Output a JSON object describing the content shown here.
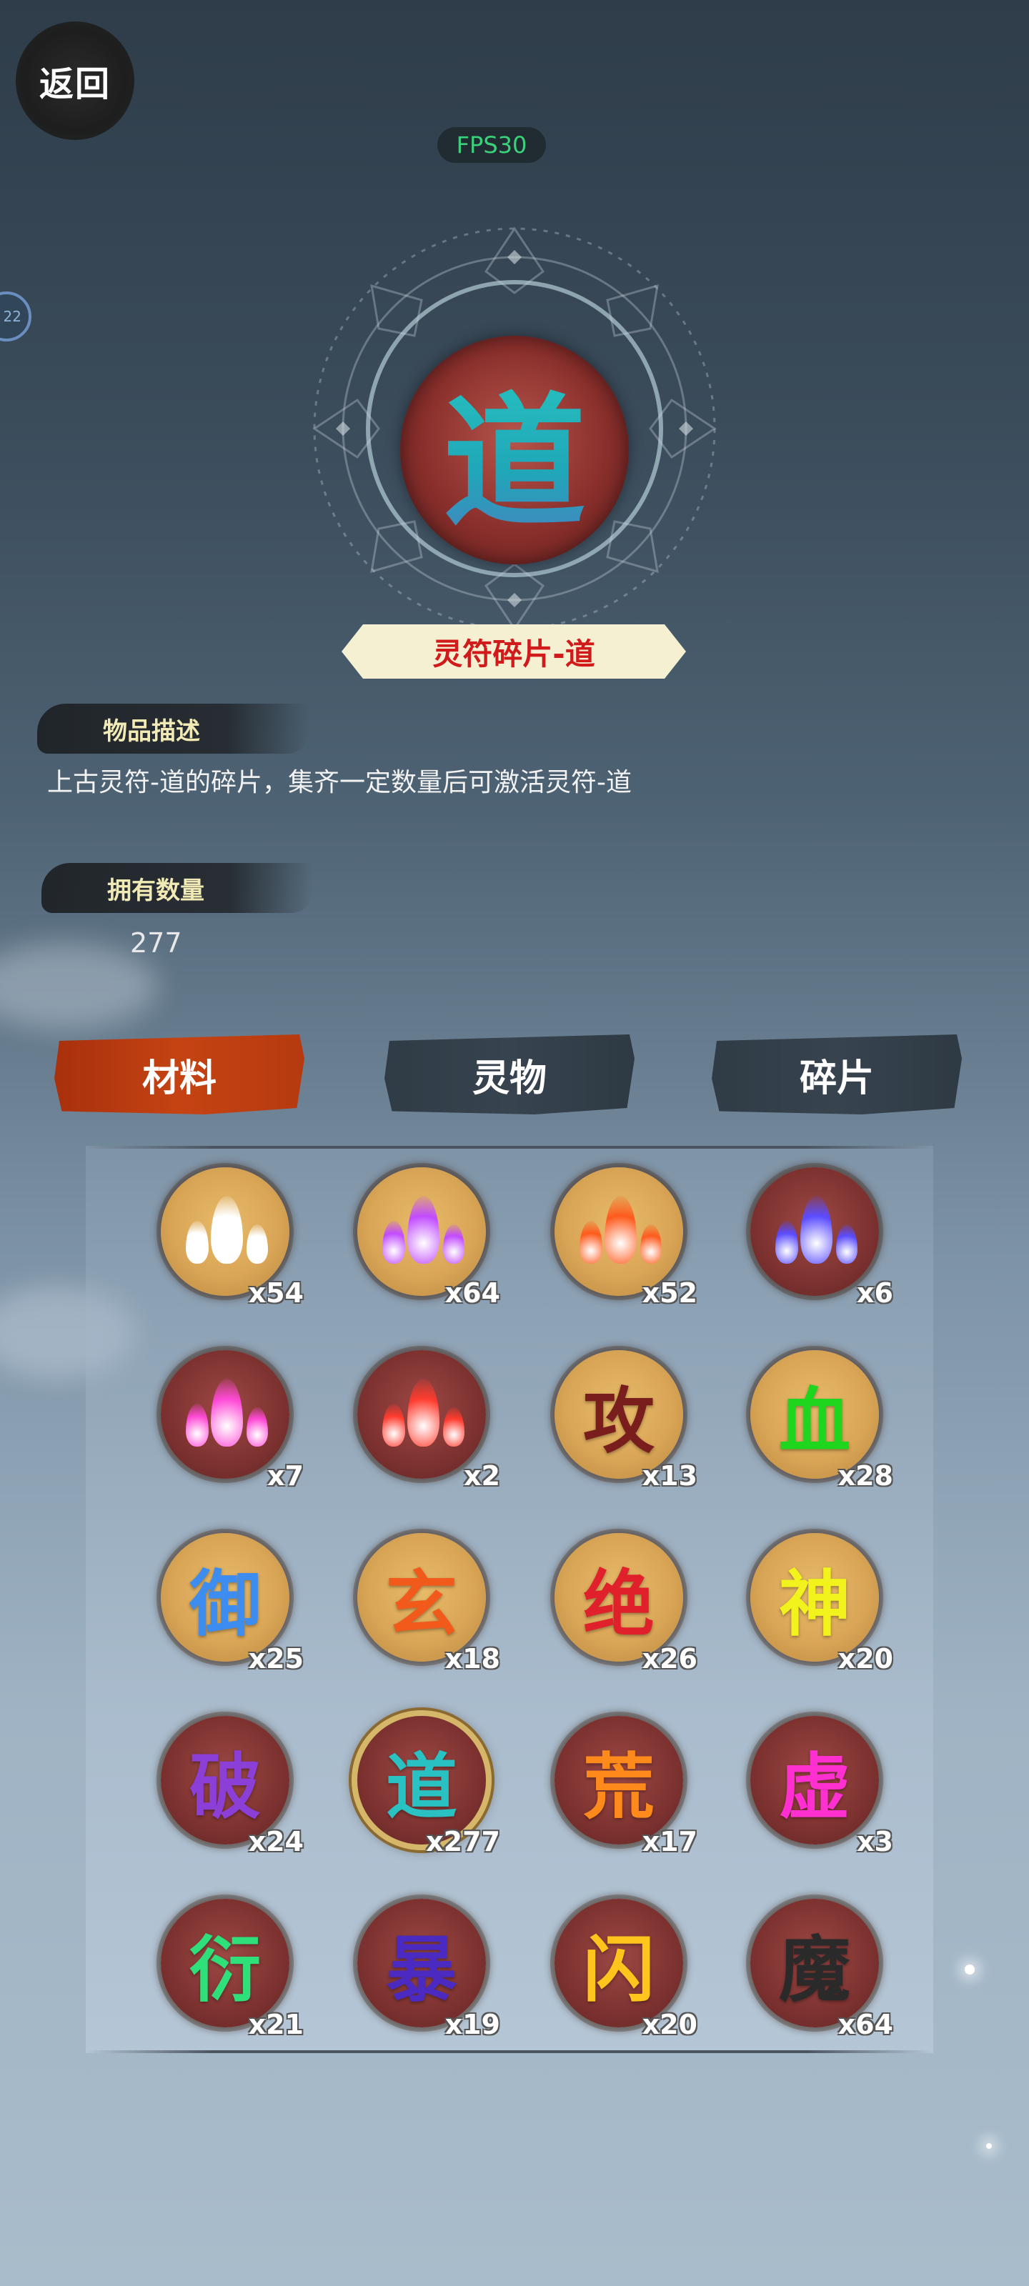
{
  "header": {
    "back_label": "返回",
    "fps_label": "FPS30",
    "side_badge_label": "22"
  },
  "item": {
    "emblem_char": "道",
    "name": "灵符碎片-道",
    "description_title": "物品描述",
    "description": "上古灵符-道的碎片，集齐一定数量后可激活灵符-道",
    "count_title": "拥有数量",
    "count": "277"
  },
  "tabs": [
    {
      "label": "材料",
      "active": true
    },
    {
      "label": "灵物",
      "active": false
    },
    {
      "label": "碎片",
      "active": false
    }
  ],
  "inventory": [
    {
      "glyph": "",
      "icon": "white-flame-icon",
      "qty": "x54",
      "bg": "gold",
      "color": "#ffffff"
    },
    {
      "glyph": "",
      "icon": "purple-flame-icon",
      "qty": "x64",
      "bg": "gold",
      "color": "#c14bff"
    },
    {
      "glyph": "",
      "icon": "orange-flame-icon",
      "qty": "x52",
      "bg": "gold",
      "color": "#ff5a1c"
    },
    {
      "glyph": "",
      "icon": "blue-flame-icon",
      "qty": "x6",
      "bg": "red",
      "color": "#5a4cff"
    },
    {
      "glyph": "",
      "icon": "pink-flame-icon",
      "qty": "x7",
      "bg": "red",
      "color": "#ff49d6"
    },
    {
      "glyph": "",
      "icon": "red-flame-icon",
      "qty": "x2",
      "bg": "red",
      "color": "#ff3b2e"
    },
    {
      "glyph": "攻",
      "icon": "",
      "qty": "x13",
      "bg": "gold",
      "color": "#7a1d1d"
    },
    {
      "glyph": "血",
      "icon": "",
      "qty": "x28",
      "bg": "gold",
      "color": "#1fd61f"
    },
    {
      "glyph": "御",
      "icon": "",
      "qty": "x25",
      "bg": "gold",
      "color": "#3d8cf0"
    },
    {
      "glyph": "玄",
      "icon": "",
      "qty": "x18",
      "bg": "gold",
      "color": "#f25a1c"
    },
    {
      "glyph": "绝",
      "icon": "",
      "qty": "x26",
      "bg": "gold",
      "color": "#e0202a"
    },
    {
      "glyph": "神",
      "icon": "",
      "qty": "x20",
      "bg": "gold",
      "color": "#f2f21c"
    },
    {
      "glyph": "破",
      "icon": "",
      "qty": "x24",
      "bg": "red",
      "color": "#8b3fd6"
    },
    {
      "glyph": "道",
      "icon": "",
      "qty": "x277",
      "bg": "red",
      "color": "#29c1c2",
      "selected": true
    },
    {
      "glyph": "荒",
      "icon": "",
      "qty": "x17",
      "bg": "red",
      "color": "#ff8a1c"
    },
    {
      "glyph": "虚",
      "icon": "",
      "qty": "x3",
      "bg": "red",
      "color": "#ff2fd0"
    },
    {
      "glyph": "衍",
      "icon": "",
      "qty": "x21",
      "bg": "red",
      "color": "#2fe07a"
    },
    {
      "glyph": "暴",
      "icon": "",
      "qty": "x19",
      "bg": "red",
      "color": "#4a2ac0"
    },
    {
      "glyph": "闪",
      "icon": "",
      "qty": "x20",
      "bg": "red",
      "color": "#ffc51c"
    },
    {
      "glyph": "魔",
      "icon": "",
      "qty": "x64",
      "bg": "red",
      "color": "#2a2a2a"
    }
  ]
}
